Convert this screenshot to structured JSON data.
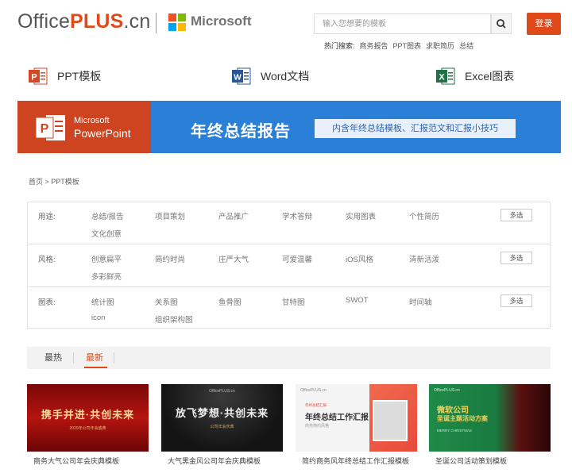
{
  "header": {
    "logo_office": "Office",
    "logo_plus": "PLUS",
    "logo_cn": ".cn",
    "ms_text": "Microsoft",
    "search_placeholder": "输入您想要的模板",
    "login_label": "登录",
    "hot_label": "热门搜索:",
    "hot_items": [
      "商务报告",
      "PPT图表",
      "求职简历",
      "总结"
    ]
  },
  "categories": [
    {
      "label": "PPT模板",
      "color": "#d24726"
    },
    {
      "label": "Word文档",
      "color": "#2b5797"
    },
    {
      "label": "Excel图表",
      "color": "#1e7145"
    }
  ],
  "banner": {
    "ms": "Microsoft",
    "pp": "PowerPoint",
    "title": "年终总结报告",
    "tag": "内含年终总结模板、汇报范文和汇报小技巧"
  },
  "breadcrumb": "首页 > PPT模板",
  "filters": {
    "more_label": "多选",
    "rows": [
      {
        "label": "用途:",
        "items": [
          "总结/报告",
          "项目策划",
          "产品推广",
          "学术答辩",
          "实用图表",
          "个性简历",
          "文化创意"
        ]
      },
      {
        "label": "风格:",
        "items": [
          "创意扁平",
          "简约时尚",
          "庄严大气",
          "可爱温馨",
          "iOS风格",
          "清新活泼",
          "多彩鲜亮"
        ]
      },
      {
        "label": "图表:",
        "items": [
          "统计图",
          "关系图",
          "鱼骨图",
          "甘特图",
          "SWOT",
          "时间轴",
          "icon",
          "组织架构图"
        ]
      }
    ]
  },
  "tabs": [
    {
      "label": "最热",
      "active": false
    },
    {
      "label": "最新",
      "active": true
    }
  ],
  "cards": [
    {
      "thumb_title": "携手并进·共创未来",
      "thumb_sub": "2020年公司年会盛典",
      "caption": "商务大气公司年会庆典模板"
    },
    {
      "thumb_brand": "OfficePLUS.cn",
      "thumb_title": "放飞梦想·共创未来",
      "thumb_sub": "公司年会庆典",
      "caption": "大气黑金风公司年会庆典模板"
    },
    {
      "thumb_brand": "OfficePLUS.cn",
      "thumb_tag": "年终总结汇报",
      "thumb_title": "年终总结工作汇报",
      "thumb_sub": "商务简约风格",
      "caption": "简约商务风年终总结工作汇报模板"
    },
    {
      "thumb_brand": "OfficePLUS.cn",
      "thumb_title": "微软公司",
      "thumb_title2": "圣诞主题活动方案",
      "thumb_sub": "MERRY CHRISTMAS",
      "caption": "圣诞公司活动策划模板"
    }
  ]
}
